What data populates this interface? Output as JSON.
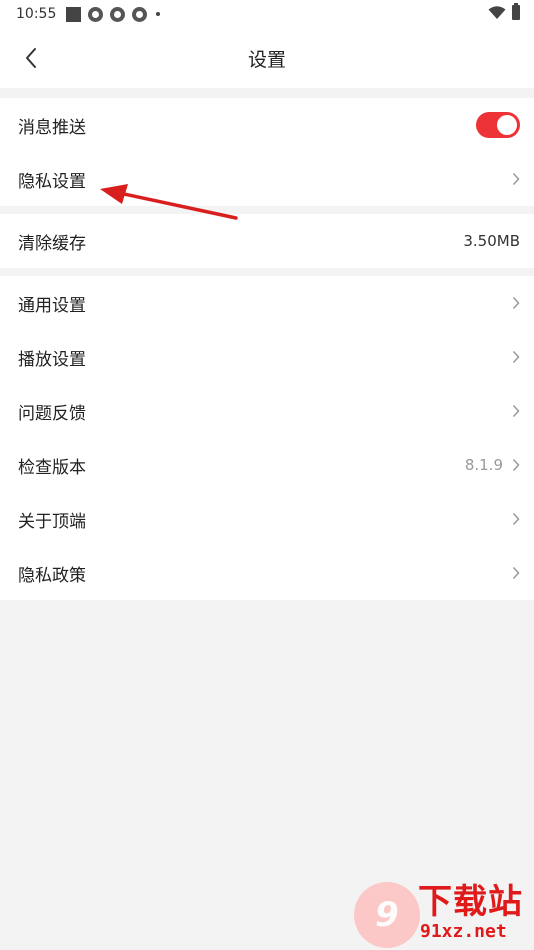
{
  "status_bar": {
    "time": "10:55"
  },
  "header": {
    "title": "设置"
  },
  "groups": [
    {
      "items": [
        {
          "label": "消息推送",
          "toggle_on": true
        },
        {
          "label": "隐私设置"
        }
      ]
    },
    {
      "items": [
        {
          "label": "清除缓存",
          "value": "3.50MB"
        }
      ]
    },
    {
      "items": [
        {
          "label": "通用设置"
        },
        {
          "label": "播放设置"
        },
        {
          "label": "问题反馈"
        },
        {
          "label": "检查版本",
          "value": "8.1.9"
        },
        {
          "label": "关于顶端"
        },
        {
          "label": "隐私政策"
        }
      ]
    }
  ],
  "accent_color": "#ee3338",
  "watermark": {
    "brand": "下载站",
    "url": "91xz.net",
    "badge": "9"
  }
}
